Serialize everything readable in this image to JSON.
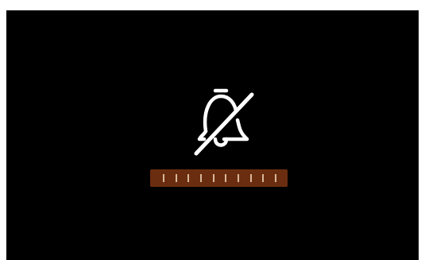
{
  "volume_hud": {
    "muted": true,
    "icon": "bell-slash-icon",
    "level": 1.0,
    "segments": 10,
    "colors": {
      "background": "#000000",
      "icon": "#ffffff",
      "bar_fill": "#6b2d0f",
      "tick": "#d8b79c"
    }
  }
}
